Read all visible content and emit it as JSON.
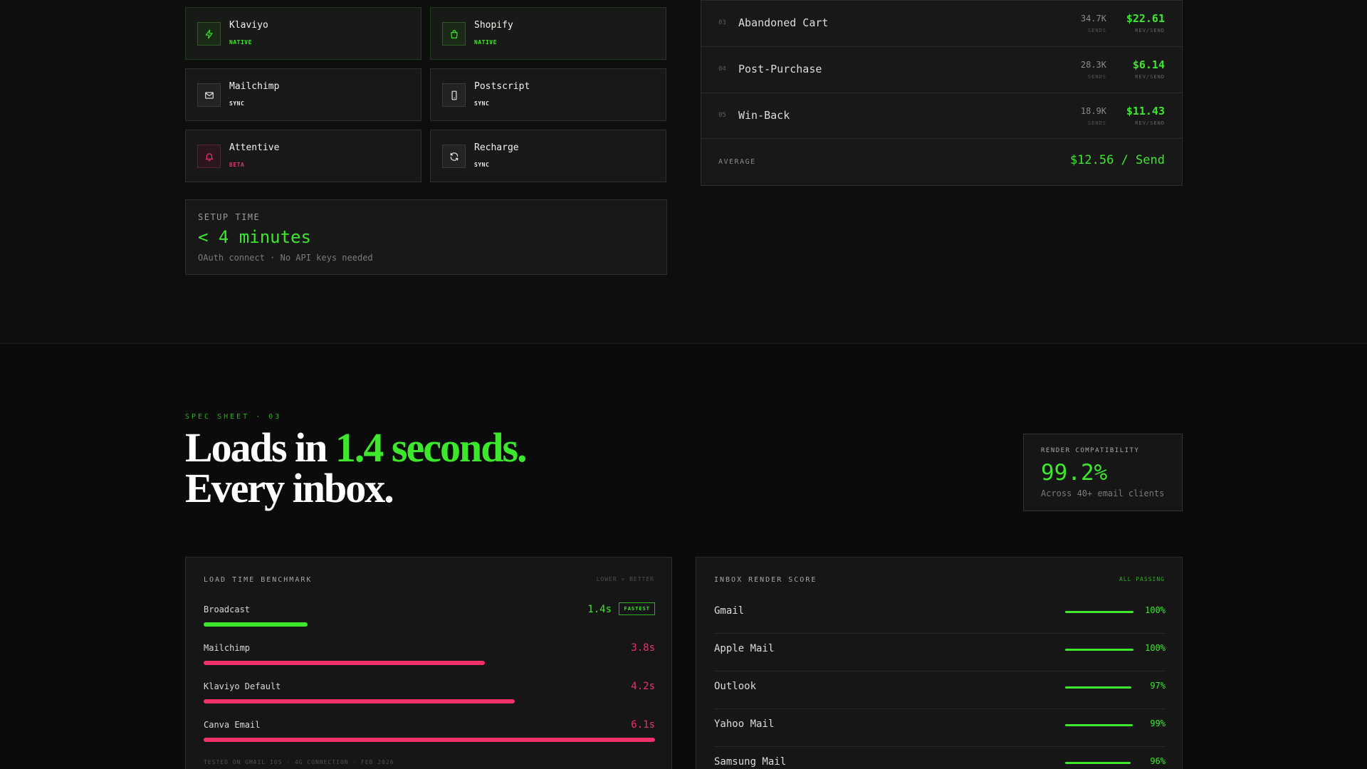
{
  "integrations": [
    {
      "name": "Klaviyo",
      "badge": "NATIVE",
      "icon": "bolt-icon"
    },
    {
      "name": "Shopify",
      "badge": "NATIVE",
      "icon": "shopping-bag-icon"
    },
    {
      "name": "Mailchimp",
      "badge": "SYNC",
      "icon": "envelope-icon"
    },
    {
      "name": "Postscript",
      "badge": "SYNC",
      "icon": "smartphone-icon"
    },
    {
      "name": "Attentive",
      "badge": "BETA",
      "icon": "bell-icon"
    },
    {
      "name": "Recharge",
      "badge": "SYNC",
      "icon": "refresh-icon"
    }
  ],
  "setup": {
    "label": "SETUP TIME",
    "value": "< 4 minutes",
    "note": "OAuth connect · No API keys needed"
  },
  "flows": {
    "rows": [
      {
        "num": "03",
        "name": "Abandoned Cart",
        "sends": "34.7K",
        "sends_label": "SENDS",
        "rev": "$22.61",
        "rev_label": "REV/SEND"
      },
      {
        "num": "04",
        "name": "Post-Purchase",
        "sends": "28.3K",
        "sends_label": "SENDS",
        "rev": "$6.14",
        "rev_label": "REV/SEND"
      },
      {
        "num": "05",
        "name": "Win-Back",
        "sends": "18.9K",
        "sends_label": "SENDS",
        "rev": "$11.43",
        "rev_label": "REV/SEND"
      }
    ],
    "average_label": "AVERAGE",
    "average_value": "$12.56 / Send"
  },
  "spec": {
    "eyebrow": "SPEC SHEET · 03",
    "headline_a": "Loads in ",
    "headline_highlight": "1.4 seconds.",
    "headline_b": "Every inbox."
  },
  "render": {
    "label": "RENDER COMPATIBILITY",
    "value": "99.2%",
    "note": "Across 40+ email clients"
  },
  "benchmark": {
    "title": "LOAD TIME BENCHMARK",
    "tag": "LOWER = BETTER",
    "fastest_badge": "FASTEST",
    "footnote": "TESTED ON GMAIL IOS · 4G CONNECTION · FEB 2026",
    "rows": [
      {
        "name": "Broadcast",
        "value": "1.4s",
        "seconds": 1.4,
        "color": "#3de82c"
      },
      {
        "name": "Mailchimp",
        "value": "3.8s",
        "seconds": 3.8,
        "color": "#f0316a"
      },
      {
        "name": "Klaviyo Default",
        "value": "4.2s",
        "seconds": 4.2,
        "color": "#f0316a"
      },
      {
        "name": "Canva Email",
        "value": "6.1s",
        "seconds": 6.1,
        "color": "#f0316a"
      }
    ]
  },
  "score": {
    "title": "INBOX RENDER SCORE",
    "tag": "ALL PASSING",
    "rows": [
      {
        "name": "Gmail",
        "value": "100%",
        "pct": 100
      },
      {
        "name": "Apple Mail",
        "value": "100%",
        "pct": 100
      },
      {
        "name": "Outlook",
        "value": "97%",
        "pct": 97
      },
      {
        "name": "Yahoo Mail",
        "value": "99%",
        "pct": 99
      },
      {
        "name": "Samsung Mail",
        "value": "96%",
        "pct": 96
      }
    ]
  },
  "colors": {
    "accent_green": "#3de82c",
    "accent_pink": "#f0316a",
    "background": "#0b0b0b"
  }
}
